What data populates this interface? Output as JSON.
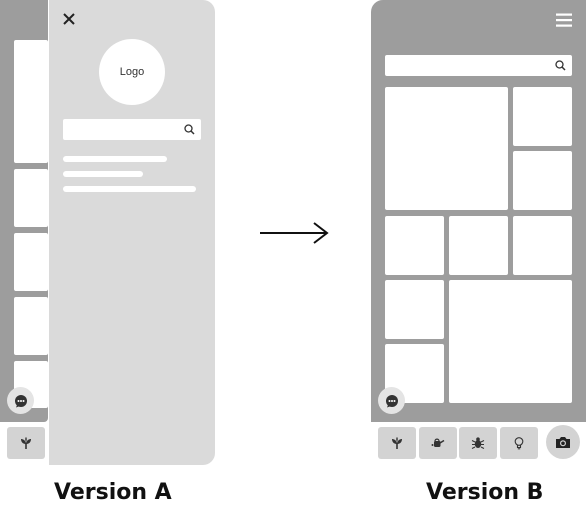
{
  "version_a": {
    "logo_label": "Logo",
    "caption": "Version A",
    "menu_lines": 3
  },
  "version_b": {
    "caption": "Version B",
    "tab_icons": [
      "plant-icon",
      "watering-can-icon",
      "bug-icon",
      "lightbulb-icon"
    ],
    "fab_icon": "camera-icon"
  },
  "icons": {
    "close": "close-icon",
    "search": "search-icon",
    "chat": "chat-bubble-icon",
    "menu": "hamburger-menu-icon",
    "arrow": "arrow-right-icon"
  },
  "colors": {
    "phone_bg": "#9d9d9d",
    "drawer_bg": "#dadada",
    "tile": "#ffffff",
    "tab_bg": "#d3d3d3"
  }
}
